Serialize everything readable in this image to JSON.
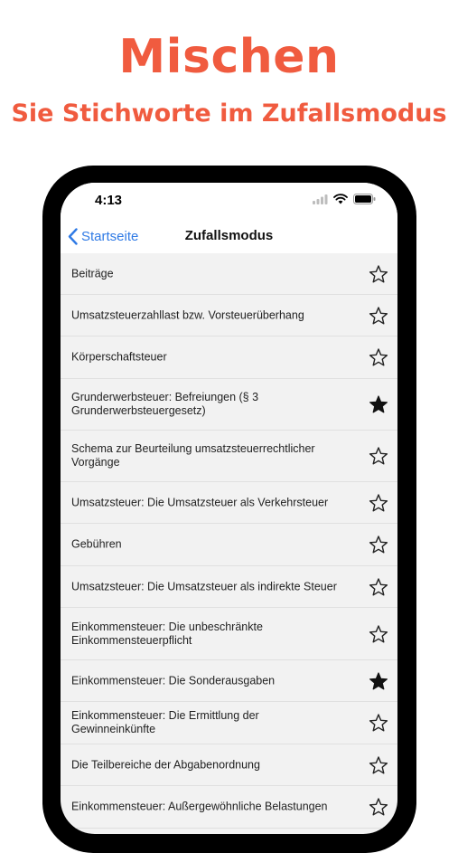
{
  "promo": {
    "headline": "Mischen",
    "subline": "Sie Stichworte im Zufallsmodus"
  },
  "status_bar": {
    "time": "4:13"
  },
  "nav": {
    "back_label": "Startseite",
    "title": "Zufallsmodus"
  },
  "items": [
    {
      "label": "Beiträge",
      "favorite": false
    },
    {
      "label": "Umsatzsteuerzahllast bzw. Vorsteuerüberhang",
      "favorite": false
    },
    {
      "label": "Körperschaftsteuer",
      "favorite": false
    },
    {
      "label": "Grunderwerbsteuer: Befreiungen (§ 3 Grunderwerbsteuergesetz)",
      "favorite": true
    },
    {
      "label": "Schema zur Beurteilung umsatzsteuerrechtlicher Vorgänge",
      "favorite": false
    },
    {
      "label": "Umsatzsteuer: Die Umsatzsteuer als Verkehrsteuer",
      "favorite": false
    },
    {
      "label": "Gebühren",
      "favorite": false
    },
    {
      "label": "Umsatzsteuer: Die Umsatzsteuer als indirekte Steuer",
      "favorite": false
    },
    {
      "label": "Einkommensteuer: Die unbeschränkte Einkommensteuerpflicht",
      "favorite": false
    },
    {
      "label": "Einkommensteuer: Die Sonderausgaben",
      "favorite": true
    },
    {
      "label": "Einkommensteuer: Die Ermittlung der Gewinneinkünfte",
      "favorite": false
    },
    {
      "label": "Die Teilbereiche der Abgabenordnung",
      "favorite": false
    },
    {
      "label": "Einkommensteuer: Außergewöhnliche Belastungen",
      "favorite": false
    }
  ],
  "colors": {
    "accent": "#f05b3f",
    "link": "#2f7ae5"
  }
}
